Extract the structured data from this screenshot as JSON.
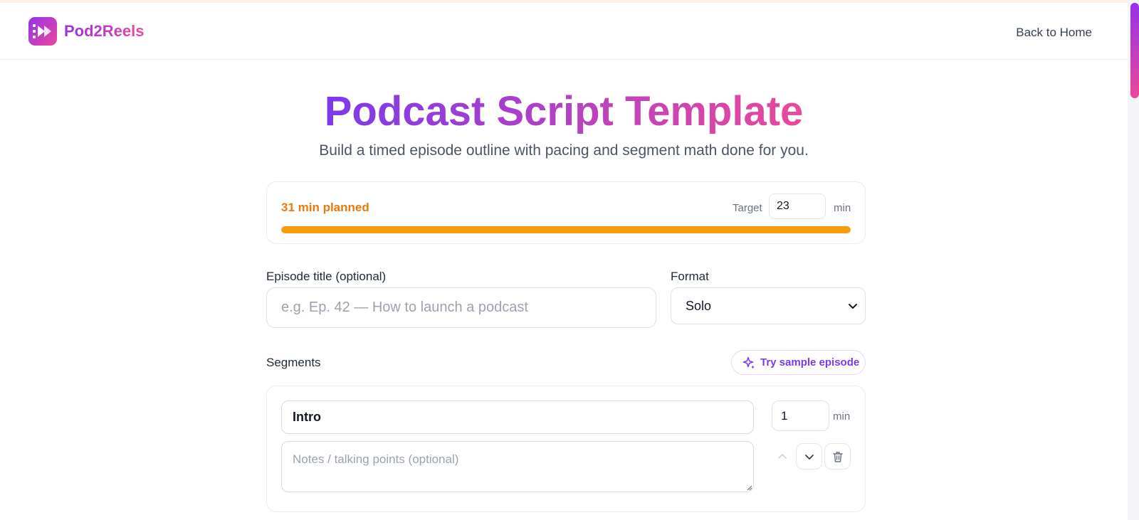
{
  "app": {
    "name": "Pod2Reels",
    "back_link": "Back to Home",
    "colors": {
      "brand_start": "#9333ea",
      "brand_end": "#ec4899",
      "warning": "#f59e0b"
    }
  },
  "hero": {
    "title": "Podcast Script Template",
    "subtitle": "Build a timed episode outline with pacing and segment math done for you."
  },
  "summary": {
    "planned_text": "31 min planned",
    "target_label": "Target",
    "target_value": "23",
    "target_unit": "min",
    "progress_percent": 100
  },
  "form": {
    "episode_title_label": "Episode title (optional)",
    "episode_title_placeholder": "e.g. Ep. 42 — How to launch a podcast",
    "episode_title_value": "",
    "format_label": "Format",
    "format_selected": "Solo"
  },
  "segments": {
    "label": "Segments",
    "sample_button": "Try sample episode",
    "items": [
      {
        "name": "Intro",
        "notes_placeholder": "Notes / talking points (optional)",
        "notes": "",
        "minutes": "1",
        "unit": "min",
        "icons": [
          "chevron-up-icon",
          "chevron-down-icon",
          "trash-icon"
        ]
      }
    ]
  }
}
